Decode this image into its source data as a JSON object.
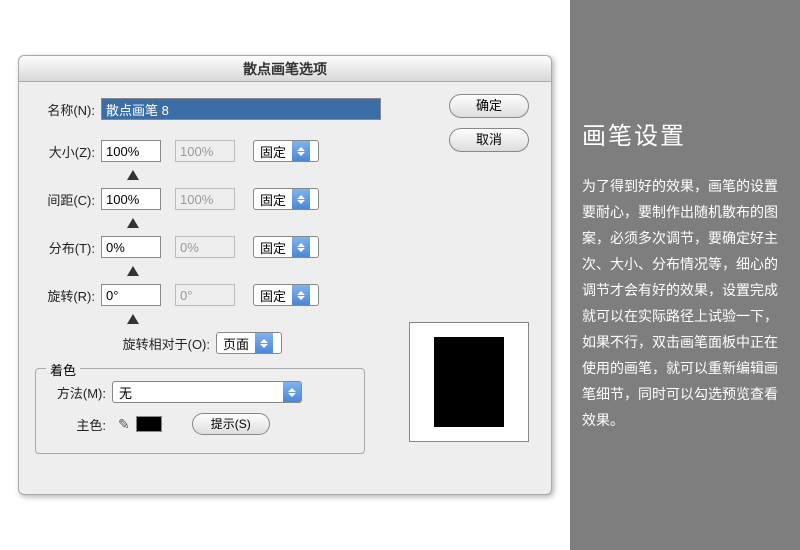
{
  "dialog": {
    "title": "散点画笔选项",
    "name_label": "名称(N):",
    "name_value": "散点画笔 8",
    "size_label": "大小(Z):",
    "size_value": "100%",
    "size_value2": "100%",
    "spacing_label": "间距(C):",
    "spacing_value": "100%",
    "spacing_value2": "100%",
    "scatter_label": "分布(T):",
    "scatter_value": "0%",
    "scatter_value2": "0%",
    "rotation_label": "旋转(R):",
    "rotation_value": "0°",
    "rotation_value2": "0°",
    "mode_fixed": "固定",
    "rotate_rel_label": "旋转相对于(O):",
    "rotate_rel_value": "页面",
    "ok": "确定",
    "cancel": "取消",
    "colorize_legend": "着色",
    "method_label": "方法(M):",
    "method_value": "无",
    "keycolor_label": "主色:",
    "tips": "提示(S)"
  },
  "side": {
    "title": "画笔设置",
    "body": "为了得到好的效果，画笔的设置要耐心，要制作出随机散布的图案，必须多次调节，要确定好主次、大小、分布情况等，细心的调节才会有好的效果，设置完成就可以在实际路径上试验一下，如果不行，双击画笔面板中正在使用的画笔，就可以重新编辑画笔细节，同时可以勾选预览查看效果。"
  }
}
